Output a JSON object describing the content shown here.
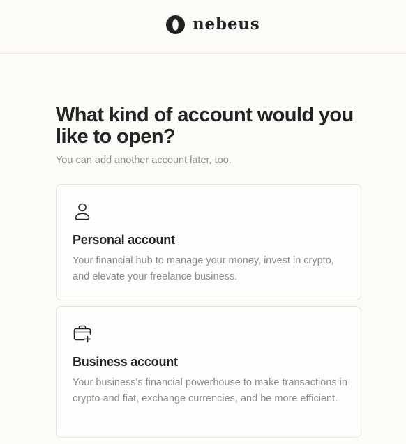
{
  "header": {
    "brand_name": "nebeus",
    "logo_icon": "nebeus-logo-icon"
  },
  "main": {
    "title": "What kind of account would you like to open?",
    "subtitle": "You can add another account later, too."
  },
  "options": [
    {
      "icon": "user-icon",
      "title": "Personal account",
      "description": "Your financial hub to manage your money, invest in crypto, and elevate your freelance business."
    },
    {
      "icon": "briefcase-plus-icon",
      "title": "Business account",
      "description": "Your business's financial powerhouse to make transactions in crypto and fiat, exchange currencies, and be more efficient."
    }
  ],
  "colors": {
    "background": "#fcfbf7",
    "text_primary": "#232323",
    "text_secondary": "#8b8b86",
    "card_border": "#e6e3dc"
  }
}
